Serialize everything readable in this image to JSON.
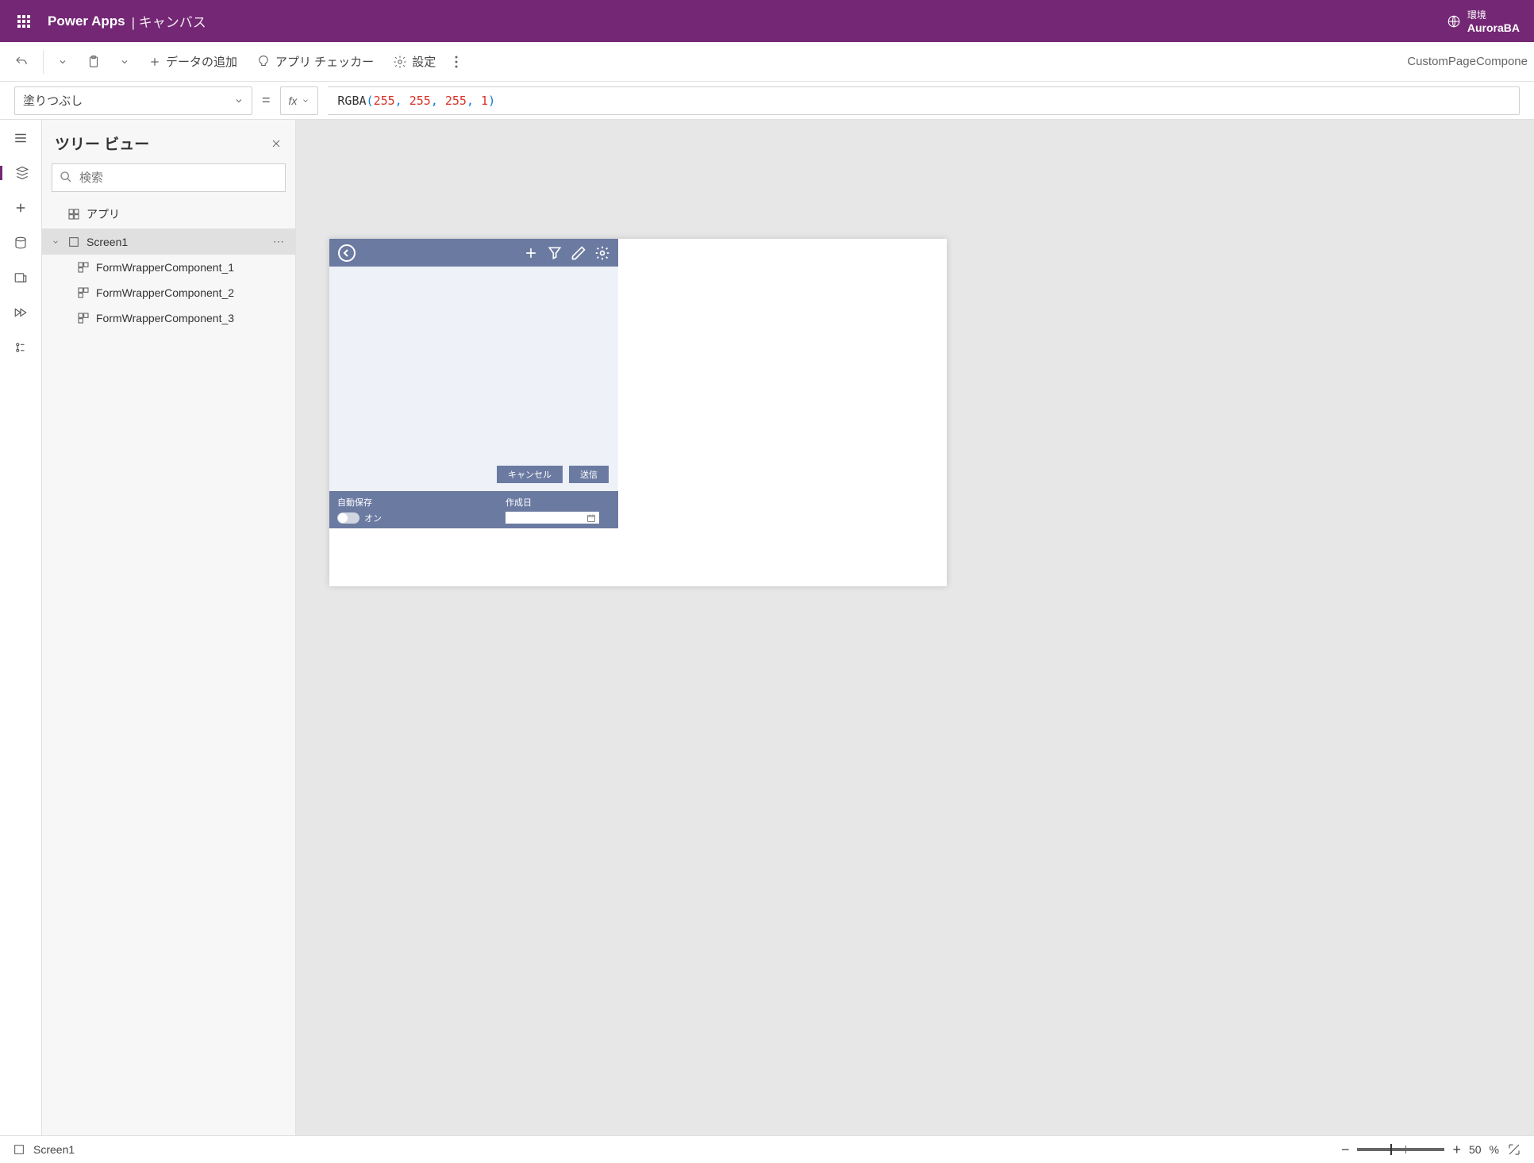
{
  "header": {
    "app_title": "Power Apps",
    "subtitle": "キャンバス",
    "env_label": "環境",
    "env_name": "AuroraBA"
  },
  "toolbar": {
    "add_data": "データの追加",
    "app_checker": "アプリ チェッカー",
    "settings": "設定",
    "page_name": "CustomPageCompone"
  },
  "formula": {
    "property": "塗りつぶし",
    "fn": "RGBA",
    "args": [
      "255",
      "255",
      "255",
      "1"
    ]
  },
  "tree": {
    "title": "ツリー ビュー",
    "search_placeholder": "検索",
    "app_node": "アプリ",
    "screen": "Screen1",
    "children": [
      "FormWrapperComponent_1",
      "FormWrapperComponent_2",
      "FormWrapperComponent_3"
    ]
  },
  "canvas": {
    "cancel": "キャンセル",
    "submit": "送信",
    "autosave": "自動保存",
    "on": "オン",
    "created_date": "作成日"
  },
  "status": {
    "screen": "Screen1",
    "zoom_value": "50",
    "zoom_pct": "%"
  }
}
